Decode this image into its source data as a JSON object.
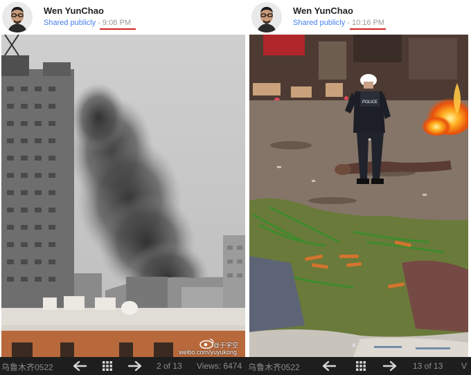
{
  "posts": [
    {
      "author": "Wen YunChao",
      "shared": "Shared publicly",
      "separator": "-",
      "time": "9:08 PM",
      "watermark_handle": "@于宇空",
      "watermark_site": "weibo.com/yuyukong",
      "bar": {
        "caption_left": "乌鲁木齐0522",
        "counter": "2 of 13",
        "views": "Views: 6474"
      }
    },
    {
      "author": "Wen YunChao",
      "shared": "Shared publicly",
      "separator": "-",
      "time": "10:16 PM",
      "police_label": "POLICE",
      "bar": {
        "caption_left": "乌鲁木齐0522",
        "counter": "13 of 13",
        "views": "V"
      }
    }
  ],
  "icons": {
    "prev": "arrow-left-icon",
    "grid": "grid-icon",
    "next": "arrow-right-icon"
  },
  "colors": {
    "link": "#427fed",
    "underline": "#d42020",
    "bar_bg": "#1e1e1e",
    "bar_text": "#8c8c8c"
  }
}
